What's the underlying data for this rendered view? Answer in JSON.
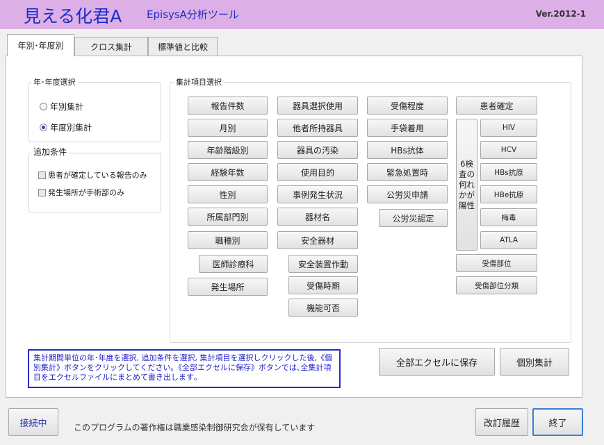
{
  "header": {
    "title": "見える化君A",
    "subtitle": "EpisysA分析ツール",
    "version": "Ver.2012-1"
  },
  "tabs": [
    {
      "label": "年別･年度別",
      "active": true
    },
    {
      "label": "クロス集計",
      "active": false
    },
    {
      "label": "標準値と比較",
      "active": false
    }
  ],
  "year_selection": {
    "title": "年･年度選択",
    "options": [
      {
        "label": "年別集計",
        "selected": false
      },
      {
        "label": "年度別集計",
        "selected": true
      }
    ]
  },
  "additional_conditions": {
    "title": "追加条件",
    "options": [
      {
        "label": "患者が確定している報告のみ",
        "checked": false
      },
      {
        "label": "発生場所が手術部のみ",
        "checked": false
      }
    ]
  },
  "item_selection": {
    "title": "集計項目選択",
    "column1": [
      "報告件数",
      "月別",
      "年齢階級別",
      "経験年数",
      "性別",
      "所属部門別",
      "職種別",
      "医師診療科",
      "発生場所"
    ],
    "column2": [
      "器具選択使用",
      "他者所持器具",
      "器具の汚染",
      "使用目的",
      "事例発生状況",
      "器材名",
      "安全器材",
      "安全装置作動",
      "受傷時期",
      "機能可否"
    ],
    "column3": [
      "受傷程度",
      "手袋着用",
      "HBs抗体",
      "緊急処置時",
      "公労災申請",
      "公労災認定"
    ],
    "column4_top": "患者確定",
    "positive_any": "6検査の何れかが陽性",
    "tests": [
      "HIV",
      "HCV",
      "HBs抗原",
      "HBe抗原",
      "梅毒",
      "ATLA"
    ],
    "column4_bottom": [
      "受傷部位",
      "受傷部位分類"
    ]
  },
  "instruction": "集計期間単位の年･年度を選択, 追加条件を選択, 集計項目を選択しクリックした後,《個別集計》ボタンをクリックしてください｡《全部エクセルに保存》ボタンでは､全集計項目をエクセルファイルにまとめて書き出します｡",
  "actions": {
    "save_all": "全部エクセルに保存",
    "individual": "個別集計"
  },
  "footer": {
    "status": "接続中",
    "copyright": "このプログラムの著作権は職業感染制御研究会が保有しています",
    "history": "改訂履歴",
    "exit": "終了"
  }
}
